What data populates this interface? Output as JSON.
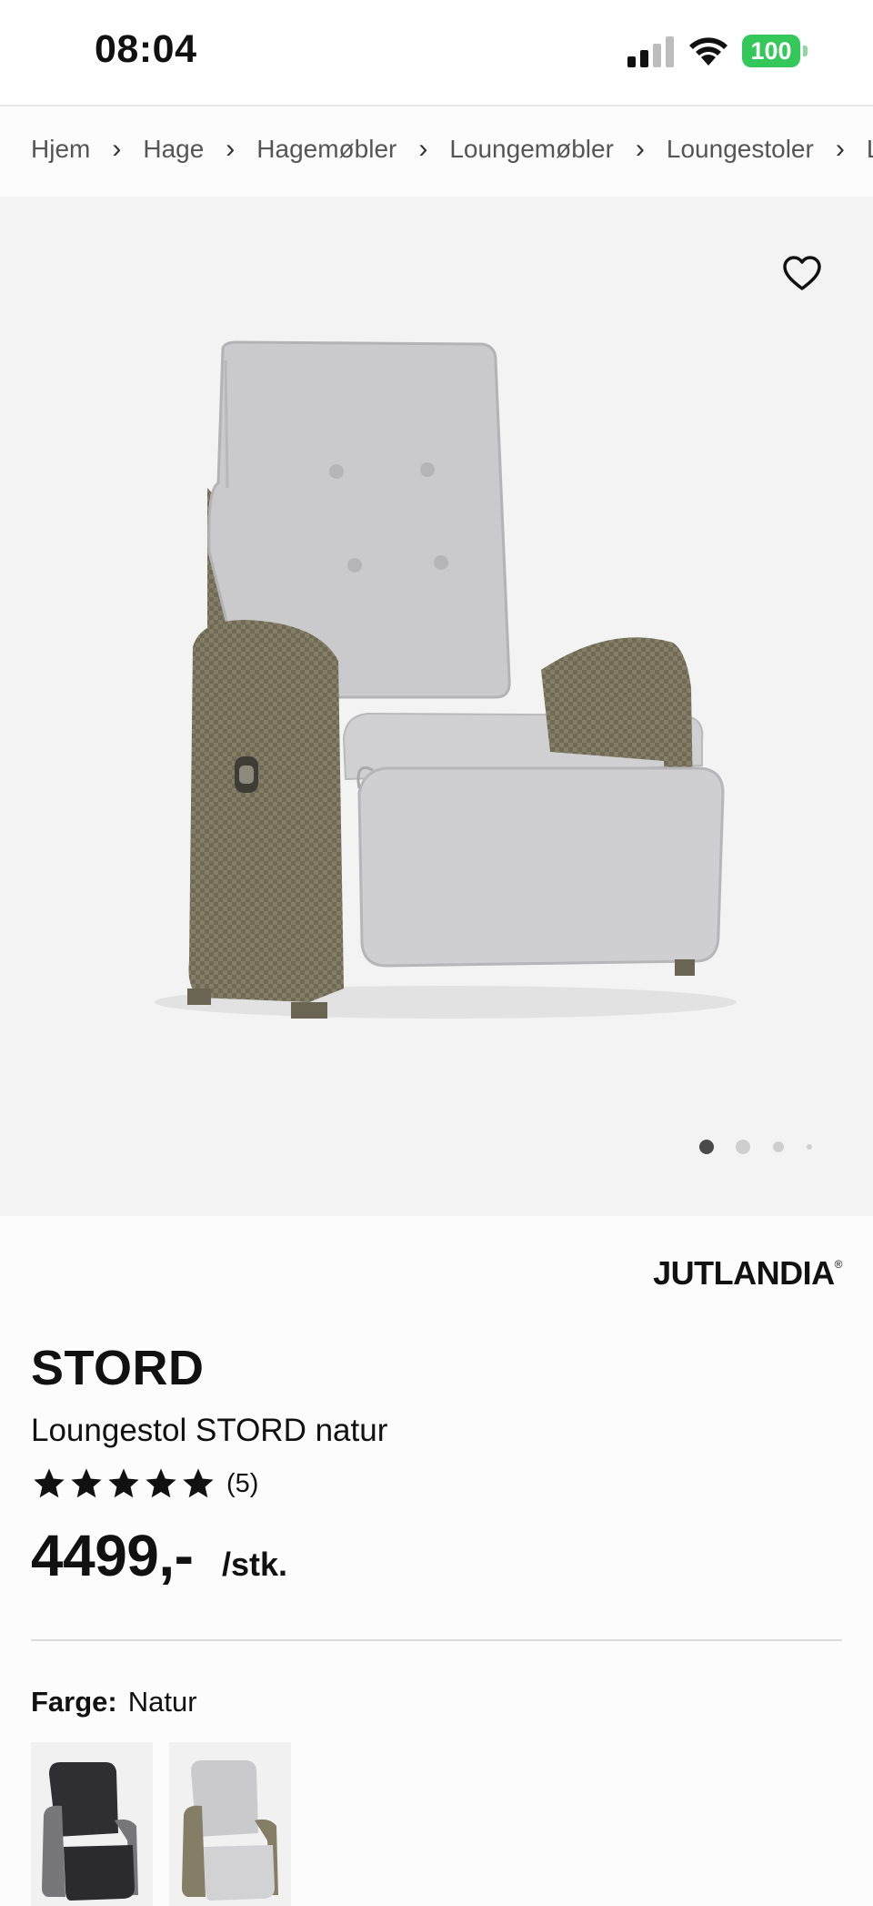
{
  "status_bar": {
    "time": "08:04",
    "battery": "100"
  },
  "breadcrumb": [
    "Hjem",
    "Hage",
    "Hagemøbler",
    "Loungemøbler",
    "Loungestoler",
    "L"
  ],
  "product": {
    "brand": "JUTLANDIA",
    "brand_mark": "®",
    "name": "STORD",
    "subtitle": "Loungestol STORD natur",
    "rating": 5,
    "rating_count": "(5)",
    "price": "4499,-",
    "unit": "/stk.",
    "color_label": "Farge:",
    "color_value": "Natur",
    "variants": [
      "black",
      "natur"
    ]
  },
  "gallery": {
    "image_count": 4,
    "active_index": 0
  },
  "colors": {
    "battery": "#34c759",
    "hero_bg": "#f3f3f3",
    "wicker": "#857e66",
    "cushion": "#c9c9cb"
  }
}
